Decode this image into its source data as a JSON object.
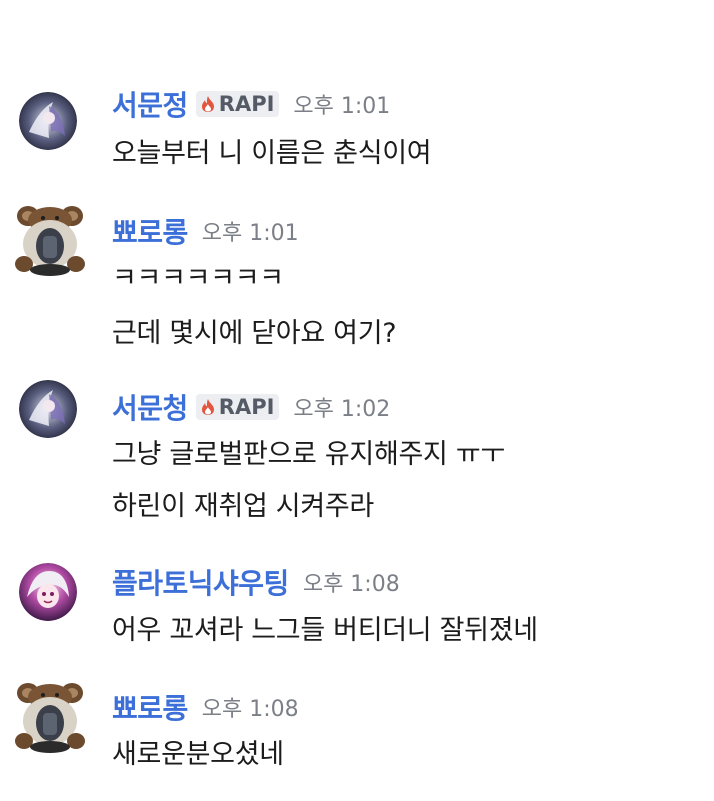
{
  "messages": [
    {
      "username": "서문정",
      "badge": "RAPI",
      "time": "오후 1:01",
      "avatar": "anime-character-dark-avatar",
      "lines": [
        "오늘부터 니 이름은 춘식이여"
      ]
    },
    {
      "username": "뾰로롱",
      "badge": "",
      "time": "오후 1:01",
      "avatar": "bear-figurine-avatar",
      "lines": [
        "ㅋㅋㅋㅋㅋㅋㅋ",
        "근데 몇시에 닫아요 여기?"
      ]
    },
    {
      "username": "서문청",
      "badge": "RAPI",
      "time": "오후 1:02",
      "avatar": "anime-character-dark-avatar",
      "lines": [
        "그냥 글로벌판으로 유지해주지 ㅠㅜ",
        "하린이 재취업 시켜주라"
      ]
    },
    {
      "username": "플라토닉샤우팅",
      "badge": "",
      "time": "오후 1:08",
      "avatar": "anime-character-pink-avatar",
      "lines": [
        "어우 꼬셔라 느그들 버티더니 잘뒤졌네"
      ]
    },
    {
      "username": "뾰로롱",
      "badge": "",
      "time": "오후 1:08",
      "avatar": "bear-figurine-avatar",
      "lines": [
        "새로운분오셨네"
      ]
    }
  ],
  "colors": {
    "username": "#3d6fd8",
    "time": "#7b7f87",
    "badge_bg": "#eceef1",
    "badge_icon": "#e2553f"
  }
}
